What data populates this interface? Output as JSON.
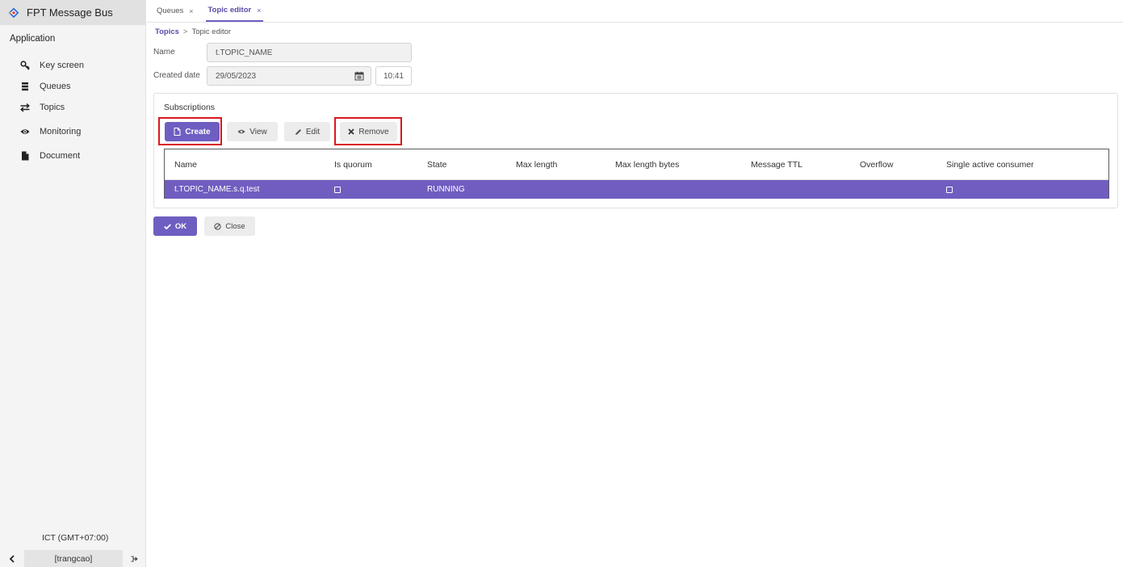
{
  "app": {
    "title": "FPT Message Bus",
    "brand_colors": {
      "blue": "#2f6fd8",
      "orange": "#f2a53a",
      "red": "#e23c3c",
      "accent": "#6f5ec1",
      "highlight": "#d9181e"
    }
  },
  "sidebar": {
    "section": "Application",
    "items": [
      {
        "label": "Key screen",
        "icon": "key-icon"
      },
      {
        "label": "Queues",
        "icon": "queue-list-icon"
      },
      {
        "label": "Topics",
        "icon": "exchange-arrows-icon"
      },
      {
        "label": "Monitoring",
        "icon": "eye-icon"
      },
      {
        "label": "Document",
        "icon": "document-icon"
      }
    ],
    "timezone": "ICT (GMT+07:00)",
    "user": "[trangcao]"
  },
  "tabs": [
    {
      "label": "Queues",
      "close": "×",
      "active": false
    },
    {
      "label": "Topic editor",
      "close": "×",
      "active": true
    }
  ],
  "breadcrumb": {
    "link": "Topics",
    "separator": ">",
    "current": "Topic editor"
  },
  "form": {
    "name_label": "Name",
    "name_value": "t.TOPIC_NAME",
    "created_label": "Created date",
    "created_date": "29/05/2023",
    "created_time": "10:41"
  },
  "subscriptions": {
    "title": "Subscriptions",
    "buttons": {
      "create": "Create",
      "view": "View",
      "edit": "Edit",
      "remove": "Remove"
    },
    "columns": [
      "Name",
      "Is quorum",
      "State",
      "Max length",
      "Max length bytes",
      "Message TTL",
      "Overflow",
      "Single active consumer"
    ],
    "rows": [
      {
        "name": "t.TOPIC_NAME.s.q.test",
        "is_quorum": false,
        "state": "RUNNING",
        "max_length": "",
        "max_length_bytes": "",
        "message_ttl": "",
        "overflow": "",
        "single_active_consumer": false
      }
    ]
  },
  "actions": {
    "ok": "OK",
    "close": "Close"
  }
}
